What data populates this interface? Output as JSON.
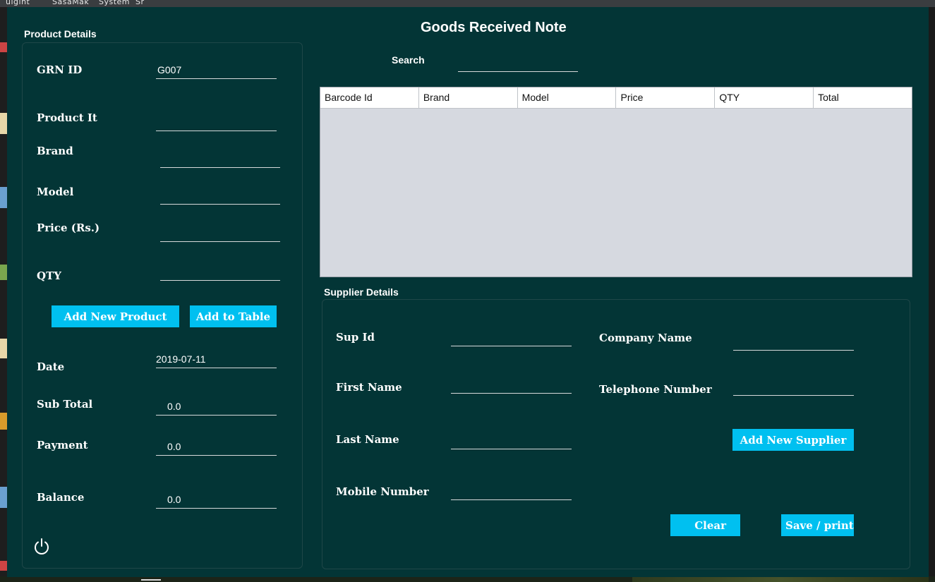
{
  "desktop": {
    "top_menu_fragments": [
      "uigint",
      "SasaMak",
      "System",
      "Sr"
    ]
  },
  "header": {
    "title": "Goods Received Note"
  },
  "product_details": {
    "heading": "Product Details",
    "grn_id": {
      "label": "GRN ID",
      "value": "G007"
    },
    "product_item": {
      "label": "Product It",
      "value": ""
    },
    "brand": {
      "label": "Brand",
      "value": ""
    },
    "model": {
      "label": "Model",
      "value": ""
    },
    "price": {
      "label": "Price (Rs.)",
      "value": ""
    },
    "qty": {
      "label": "QTY",
      "value": ""
    },
    "add_new_product_label": "Add New Product",
    "add_to_table_label": "Add to Table",
    "date": {
      "label": "Date",
      "value": "2019-07-11"
    },
    "sub_total": {
      "label": "Sub Total",
      "value": "0.0"
    },
    "payment": {
      "label": "Payment",
      "value": "0.0"
    },
    "balance": {
      "label": "Balance",
      "value": "0.0"
    },
    "power_icon": "power-icon"
  },
  "search": {
    "label": "Search",
    "value": ""
  },
  "table": {
    "columns": [
      "Barcode Id",
      "Brand",
      "Model",
      "Price",
      "QTY",
      "Total"
    ],
    "rows": []
  },
  "supplier_details": {
    "heading": "Supplier Details",
    "sup_id": {
      "label": "Sup Id",
      "value": ""
    },
    "first_name": {
      "label": "First Name",
      "value": ""
    },
    "last_name": {
      "label": "Last Name",
      "value": ""
    },
    "mobile_number": {
      "label": "Mobile Number",
      "value": ""
    },
    "company_name": {
      "label": "Company Name",
      "value": ""
    },
    "telephone_number": {
      "label": "Telephone Number",
      "value": ""
    },
    "add_new_supplier_label": "Add New Supplier",
    "clear_label": "Clear",
    "save_print_label": "Save / print"
  },
  "colors": {
    "window_bg": "#033536",
    "button_bg": "#00c0f0",
    "table_bg": "#d6d9e0"
  }
}
